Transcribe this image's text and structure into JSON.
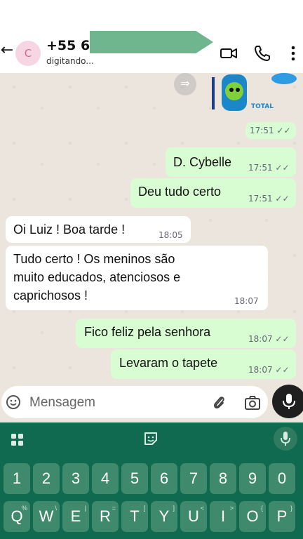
{
  "header": {
    "back_icon": "arrow-left-icon",
    "avatar_letter": "C",
    "contact_number": "+55 62",
    "status": "digitando...",
    "video_icon": "video-call-icon",
    "call_icon": "phone-icon",
    "menu_icon": "more-vertical-icon"
  },
  "chat": {
    "sticker_time": "17:51 ✓✓",
    "messages": [
      {
        "dir": "out",
        "text": "D. Cybelle",
        "time": "17:51 ✓✓"
      },
      {
        "dir": "out",
        "text": "Deu tudo certo",
        "time": "17:51 ✓✓"
      },
      {
        "dir": "in",
        "text": "Oi Luiz ! Boa tarde !",
        "time": "18:05"
      },
      {
        "dir": "in",
        "text": "Tudo certo ! Os meninos são\nmuito educados, atenciosos e\ncaprichosos !",
        "time": "18:07"
      },
      {
        "dir": "out",
        "text": "Fico feliz pela senhora",
        "time": "18:07 ✓✓"
      },
      {
        "dir": "out",
        "text": "Levaram o tapete",
        "time": "18:07 ✓✓"
      }
    ]
  },
  "input": {
    "placeholder": "Mensagem"
  },
  "keyboard": {
    "number_row": [
      "1",
      "2",
      "3",
      "4",
      "5",
      "6",
      "7",
      "8",
      "9",
      "0"
    ],
    "letter_row": [
      "Q",
      "W",
      "E",
      "R",
      "T",
      "Y",
      "U",
      "I",
      "O",
      "P"
    ],
    "letter_hints": [
      "%",
      "\\",
      "|",
      "=",
      "[",
      "]",
      "<",
      ">",
      "{",
      "}"
    ]
  },
  "colors": {
    "outgoing_bubble": "#d9fdd3",
    "incoming_bubble": "#ffffff",
    "keyboard_bg": "#0f6a4f",
    "key_bg": "#3f8a6d"
  }
}
